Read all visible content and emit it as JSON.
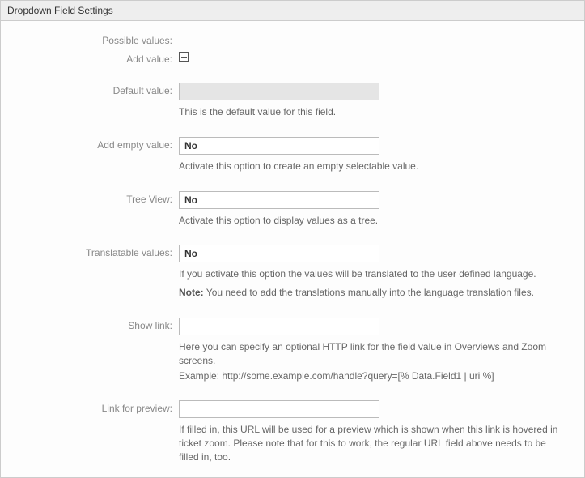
{
  "panel": {
    "title": "Dropdown Field Settings"
  },
  "labels": {
    "possible_values": "Possible values:",
    "add_value": "Add value:",
    "default_value": "Default value:",
    "add_empty_value": "Add empty value:",
    "tree_view": "Tree View:",
    "translatable_values": "Translatable values:",
    "show_link": "Show link:",
    "link_for_preview": "Link for preview:"
  },
  "values": {
    "default_value": "",
    "add_empty_value": "No",
    "tree_view": "No",
    "translatable_values": "No",
    "show_link": "",
    "link_for_preview": ""
  },
  "help": {
    "default_value": "This is the default value for this field.",
    "add_empty_value": "Activate this option to create an empty selectable value.",
    "tree_view": "Activate this option to display values as a tree.",
    "translatable_values_1": "If you activate this option the values will be translated to the user defined language.",
    "translatable_note_label": "Note:",
    "translatable_values_2": " You need to add the translations manually into the language translation files.",
    "show_link_1": "Here you can specify an optional HTTP link for the field value in Overviews and Zoom screens.",
    "show_link_2": "Example: http://some.example.com/handle?query=[% Data.Field1 | uri %]",
    "link_for_preview": "If filled in, this URL will be used for a preview which is shown when this link is hovered in ticket zoom. Please note that for this to work, the regular URL field above needs to be filled in, too."
  }
}
